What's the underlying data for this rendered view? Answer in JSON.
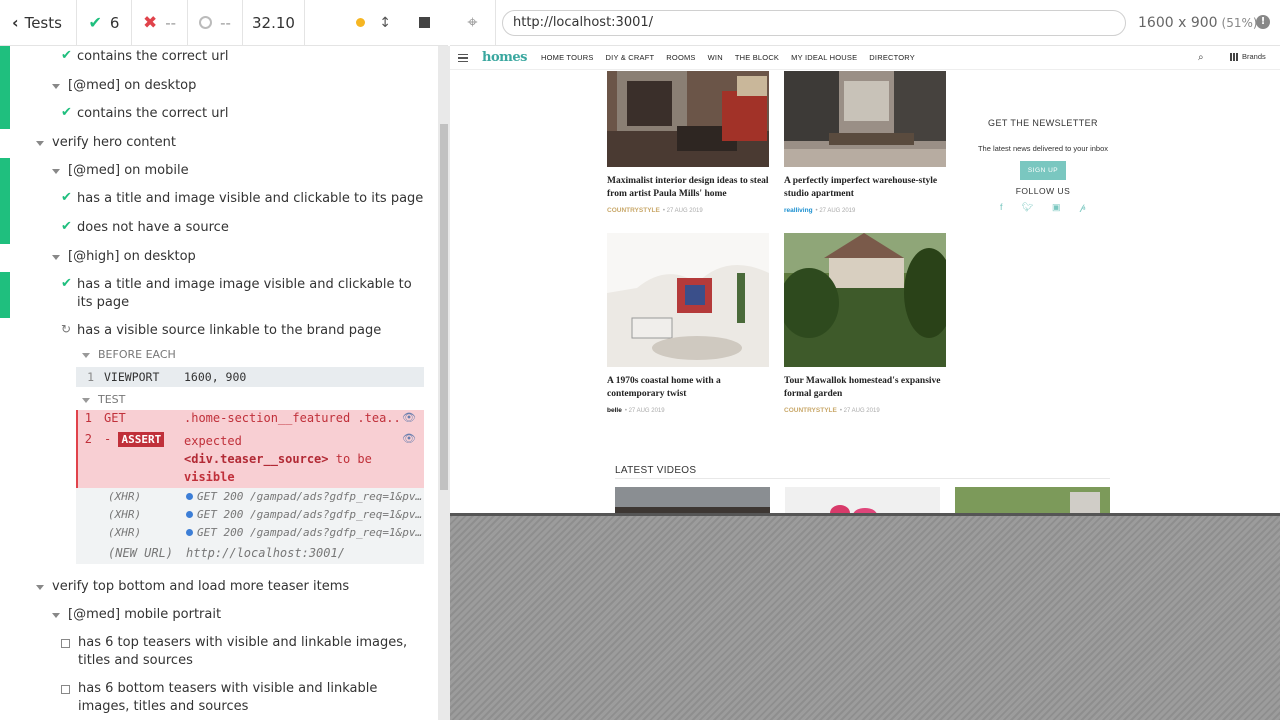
{
  "header": {
    "tests_label": "Tests",
    "passed": "6",
    "failed": "--",
    "pending": "--",
    "duration": "32.10"
  },
  "reporter": {
    "items": [
      {
        "text": "contains the correct url"
      },
      {
        "text": "[@med] on desktop"
      },
      {
        "text": "contains the correct url"
      },
      {
        "text": "verify hero content"
      },
      {
        "text": "[@med] on mobile"
      },
      {
        "text": "has a title and image visible and clickable to its page"
      },
      {
        "text": "does not have a source"
      },
      {
        "text": "[@high] on desktop"
      },
      {
        "text": "has a title and image image visible and clickable to"
      },
      {
        "text": "its page"
      },
      {
        "text": "has a visible source linkable to the brand page"
      },
      {
        "text": "verify top bottom and load more teaser items"
      },
      {
        "text": "[@med] mobile portrait"
      },
      {
        "text": "has 6 top teasers with visible and linkable images,"
      },
      {
        "text": "titles and sources"
      },
      {
        "text": "has 6 bottom teasers with visible and linkable"
      },
      {
        "text": "images, titles and sources"
      }
    ],
    "before_each_label": "BEFORE EACH",
    "viewport_cmd": {
      "num": "1",
      "name": "VIEWPORT",
      "msg": "1600, 900"
    },
    "test_label": "TEST",
    "get_cmd": {
      "num": "1",
      "name": "GET",
      "msg": ".home-section__featured .tea..."
    },
    "assert_cmd": {
      "num": "2",
      "dash": "-",
      "name": "ASSERT",
      "msg1": "expected",
      "msg2": "<div.teaser__source>",
      "msg3": "to be",
      "msg4": "visible"
    },
    "xhr": [
      {
        "k": "(XHR)",
        "v": "GET 200 /gampad/ads?gdfp_req=1&pvsi..."
      },
      {
        "k": "(XHR)",
        "v": "GET 200 /gampad/ads?gdfp_req=1&pvsi..."
      },
      {
        "k": "(XHR)",
        "v": "GET 200 /gampad/ads?gdfp_req=1&pvsi..."
      }
    ],
    "new_url": {
      "k": "(NEW URL)",
      "v": "http://localhost:3001/"
    }
  },
  "aut": {
    "url": "http://localhost:3001/",
    "viewport": "1600 x 900",
    "scale": "(51%)"
  },
  "site": {
    "logo": "homes",
    "nav": [
      "HOME TOURS",
      "DIY & CRAFT",
      "ROOMS",
      "WIN",
      "THE BLOCK",
      "MY IDEAL HOUSE",
      "DIRECTORY"
    ],
    "brands": "Brands",
    "cards": [
      {
        "title": "Maximalist interior design ideas to steal from artist Paula Mills' home",
        "brand": "COUNTRYSTYLE",
        "date": "• 27 AUG 2019",
        "brand_color": "#c9a86a"
      },
      {
        "title": "A perfectly imperfect warehouse-style studio apartment",
        "brand": "realliving",
        "date": "• 27 AUG 2019",
        "brand_color": "#1a8fd0"
      },
      {
        "title": "A 1970s coastal home with a contemporary twist",
        "brand": "belle",
        "date": "• 27 AUG 2019",
        "brand_color": "#111111"
      },
      {
        "title": "Tour Mawallok homestead's expansive formal garden",
        "brand": "COUNTRYSTYLE",
        "date": "• 27 AUG 2019",
        "brand_color": "#c9a86a"
      }
    ],
    "newsletter_title": "GET THE NEWSLETTER",
    "newsletter_sub": "The latest news delivered to your inbox",
    "signup": "SIGN UP",
    "follow": "FOLLOW US",
    "latest_videos": "LATEST VIDEOS"
  }
}
